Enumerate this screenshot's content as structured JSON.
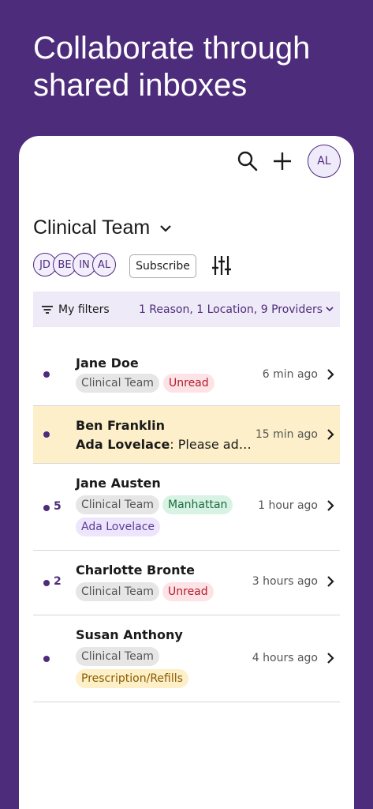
{
  "headline": {
    "line1": "Collaborate through",
    "line2": "shared inboxes"
  },
  "topbar": {
    "avatar_initials": "AL"
  },
  "team": {
    "title": "Clinical Team",
    "members": [
      "JD",
      "BE",
      "IN",
      "AL"
    ],
    "subscribe_label": "Subscribe"
  },
  "filters": {
    "label": "My filters",
    "summary": "1 Reason, 1 Location, 9 Providers"
  },
  "conversations": [
    {
      "name": "Jane Doe",
      "tags": [
        "Clinical Team",
        "Unread"
      ],
      "time": "6 min ago",
      "unread_count": ""
    },
    {
      "name": "Ben Franklin",
      "preview_sender": "Ada Lovelace",
      "preview_text": ": Please add t…",
      "time": "15 min ago",
      "unread_count": ""
    },
    {
      "name": "Jane Austen",
      "tags": [
        "Clinical Team",
        "Manhattan",
        "Ada Lovelace"
      ],
      "time": "1 hour ago",
      "unread_count": "5"
    },
    {
      "name": "Charlotte Bronte",
      "tags": [
        "Clinical Team",
        "Unread"
      ],
      "time": "3 hours ago",
      "unread_count": "2"
    },
    {
      "name": "Susan Anthony",
      "tags": [
        "Clinical Team",
        "Prescription/Refills"
      ],
      "time": "4 hours ago",
      "unread_count": ""
    }
  ],
  "colors": {
    "brand": "#4e2c7c",
    "highlight_row": "#fcefc9",
    "filter_bar": "#eeeaf7"
  }
}
